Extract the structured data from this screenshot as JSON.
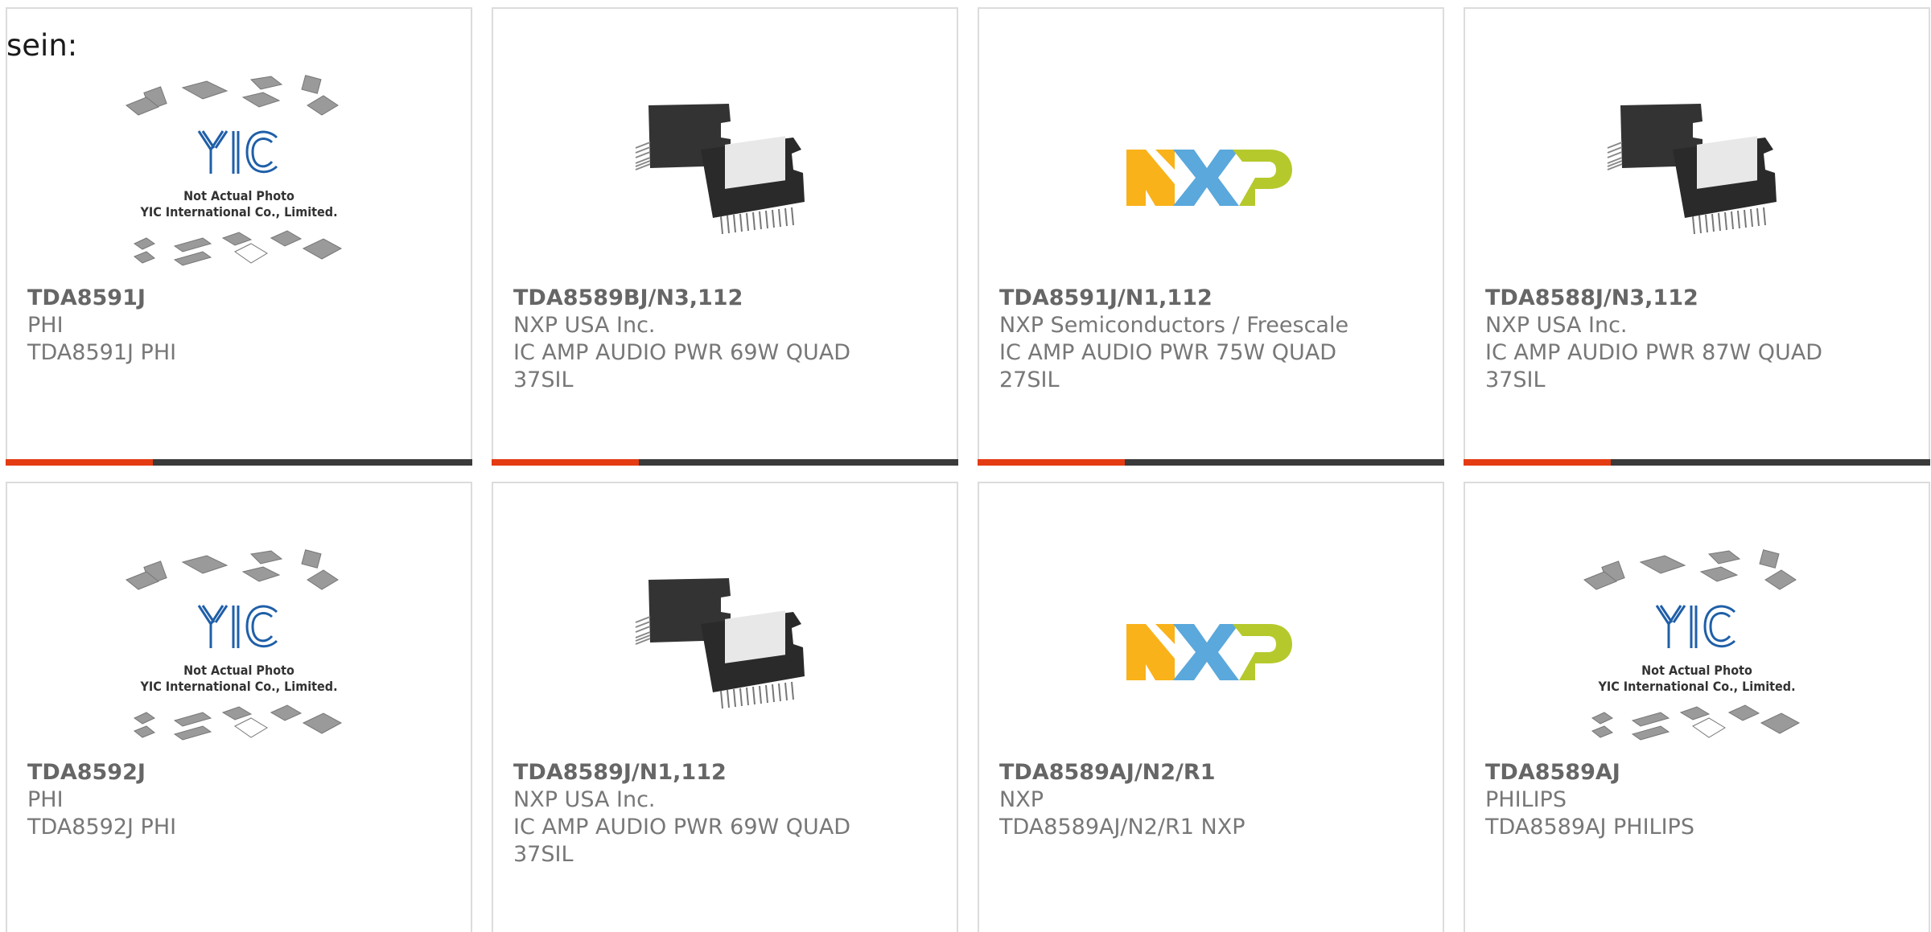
{
  "intro": "sein:",
  "colors": {
    "accent": "#e43b12",
    "bar": "#3a3a3a",
    "border": "#dcdcdc"
  },
  "placeholder": {
    "line1": "Not Actual Photo",
    "line2": "YIC International Co., Limited.",
    "logo": "YIC"
  },
  "products": [
    {
      "part": "TDA8591J",
      "brand": "PHI",
      "desc": "TDA8591J PHI",
      "image": "yic-placeholder"
    },
    {
      "part": "TDA8589BJ/N3,112",
      "brand": "NXP USA Inc.",
      "desc": "IC AMP AUDIO PWR 69W QUAD 37SIL",
      "image": "ic-package"
    },
    {
      "part": "TDA8591J/N1,112",
      "brand": "NXP Semiconductors / Freescale",
      "desc": "IC AMP AUDIO PWR 75W QUAD 27SIL",
      "image": "nxp-logo"
    },
    {
      "part": "TDA8588J/N3,112",
      "brand": "NXP USA Inc.",
      "desc": "IC AMP AUDIO PWR 87W QUAD 37SIL",
      "image": "ic-package"
    },
    {
      "part": "TDA8592J",
      "brand": "PHI",
      "desc": "TDA8592J PHI",
      "image": "yic-placeholder"
    },
    {
      "part": "TDA8589J/N1,112",
      "brand": "NXP USA Inc.",
      "desc": "IC AMP AUDIO PWR 69W QUAD 37SIL",
      "image": "ic-package"
    },
    {
      "part": "TDA8589AJ/N2/R1",
      "brand": "NXP",
      "desc": "TDA8589AJ/N2/R1 NXP",
      "image": "nxp-logo"
    },
    {
      "part": "TDA8589AJ",
      "brand": "PHILIPS",
      "desc": "TDA8589AJ PHILIPS",
      "image": "yic-placeholder"
    }
  ]
}
